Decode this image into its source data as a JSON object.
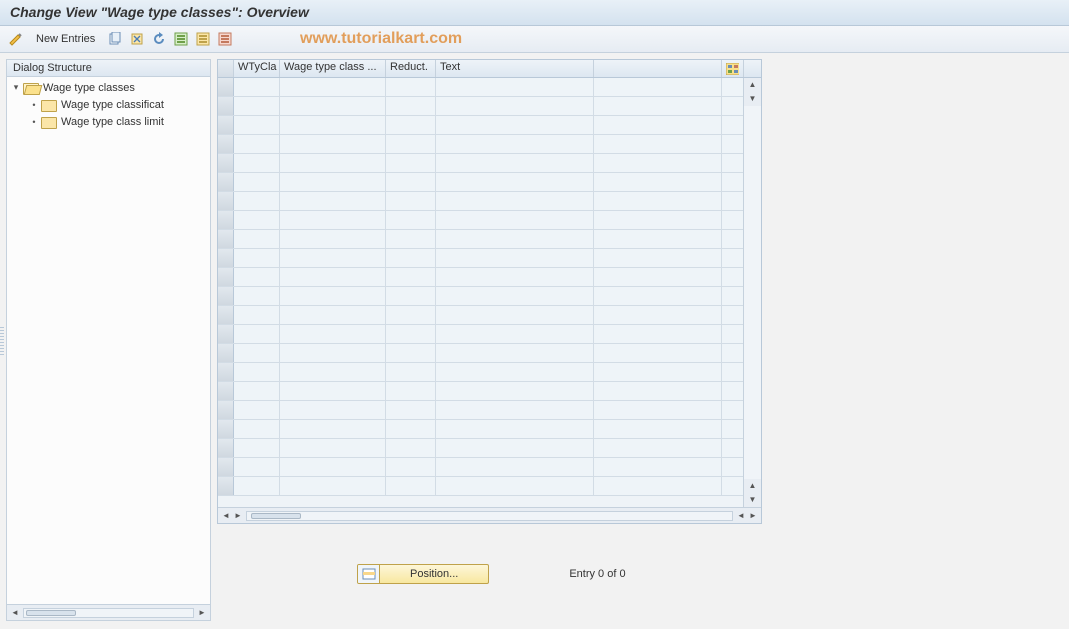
{
  "title": "Change View \"Wage type classes\": Overview",
  "toolbar": {
    "new_entries": "New Entries"
  },
  "watermark": "www.tutorialkart.com",
  "sidebar": {
    "title": "Dialog Structure",
    "items": [
      {
        "label": "Wage type classes",
        "open": true,
        "children": [
          {
            "label": "Wage type classificat"
          },
          {
            "label": "Wage type class limit"
          }
        ]
      }
    ]
  },
  "table": {
    "columns": [
      "WTyCla",
      "Wage type class ...",
      "Reduct.",
      "Text"
    ],
    "rows": 22
  },
  "footer": {
    "position_label": "Position...",
    "entry_text": "Entry 0 of 0"
  }
}
